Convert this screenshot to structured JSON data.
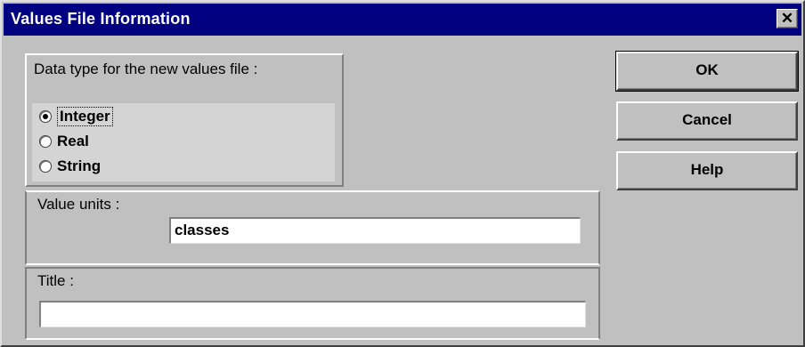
{
  "window": {
    "title": "Values File Information",
    "close_glyph": "✕"
  },
  "data_type": {
    "label": "Data type for the new values file :",
    "options": [
      {
        "label": "Integer",
        "selected": true
      },
      {
        "label": "Real",
        "selected": false
      },
      {
        "label": "String",
        "selected": false
      }
    ]
  },
  "value_units": {
    "label": "Value units :",
    "value": "classes"
  },
  "title_field": {
    "label": "Title :",
    "value": ""
  },
  "buttons": {
    "ok": "OK",
    "cancel": "Cancel",
    "help": "Help"
  },
  "colors": {
    "titlebar": "#000080",
    "face": "#c0c0c0"
  }
}
